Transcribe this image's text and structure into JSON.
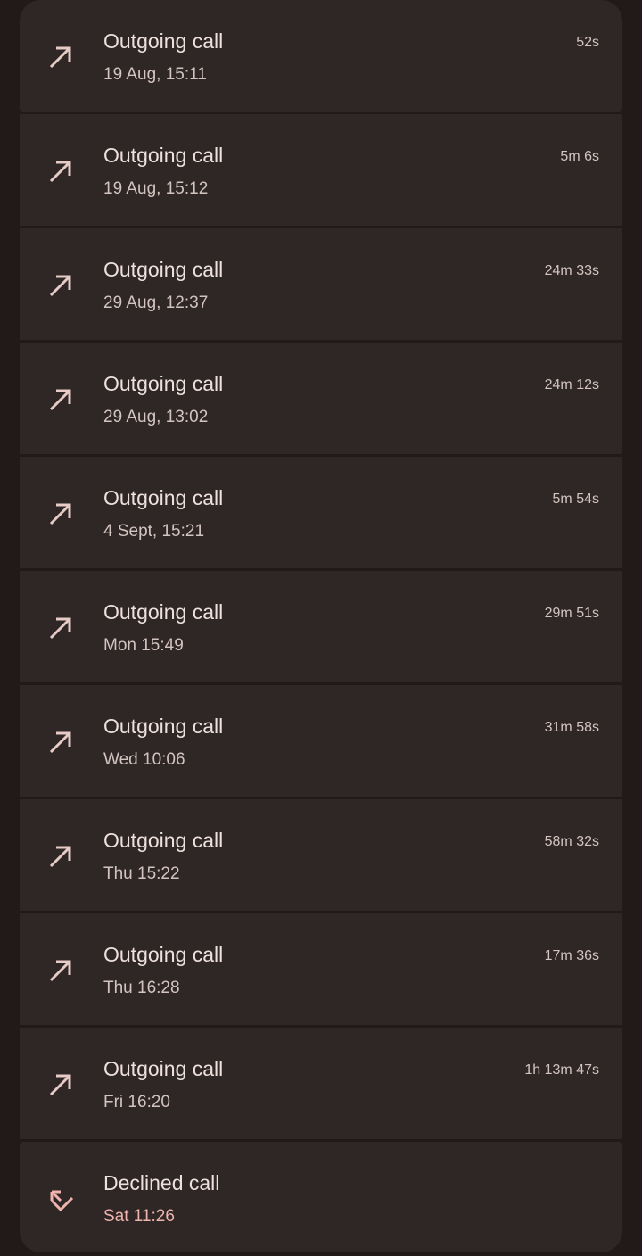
{
  "calls": [
    {
      "type": "Outgoing call",
      "time": "19 Aug, 15:11",
      "duration": "52s",
      "icon": "outgoing-arrow-icon"
    },
    {
      "type": "Outgoing call",
      "time": "19 Aug, 15:12",
      "duration": "5m 6s",
      "icon": "outgoing-arrow-icon"
    },
    {
      "type": "Outgoing call",
      "time": "29 Aug, 12:37",
      "duration": "24m 33s",
      "icon": "outgoing-arrow-icon"
    },
    {
      "type": "Outgoing call",
      "time": "29 Aug, 13:02",
      "duration": "24m 12s",
      "icon": "outgoing-arrow-icon"
    },
    {
      "type": "Outgoing call",
      "time": "4 Sept, 15:21",
      "duration": "5m 54s",
      "icon": "outgoing-arrow-icon"
    },
    {
      "type": "Outgoing call",
      "time": "Mon 15:49",
      "duration": "29m 51s",
      "icon": "outgoing-arrow-icon"
    },
    {
      "type": "Outgoing call",
      "time": "Wed 10:06",
      "duration": "31m 58s",
      "icon": "outgoing-arrow-icon"
    },
    {
      "type": "Outgoing call",
      "time": "Thu 15:22",
      "duration": "58m 32s",
      "icon": "outgoing-arrow-icon"
    },
    {
      "type": "Outgoing call",
      "time": "Thu 16:28",
      "duration": "17m 36s",
      "icon": "outgoing-arrow-icon"
    },
    {
      "type": "Outgoing call",
      "time": "Fri 16:20",
      "duration": "1h 13m 47s",
      "icon": "outgoing-arrow-icon"
    },
    {
      "type": "Declined call",
      "time": "Sat 11:26",
      "duration": "",
      "icon": "declined-call-icon"
    }
  ],
  "colors": {
    "outgoing_icon": "#e6cbc7",
    "declined_icon": "#f0b4ae",
    "background": "#211a19",
    "card": "#2f2725"
  }
}
